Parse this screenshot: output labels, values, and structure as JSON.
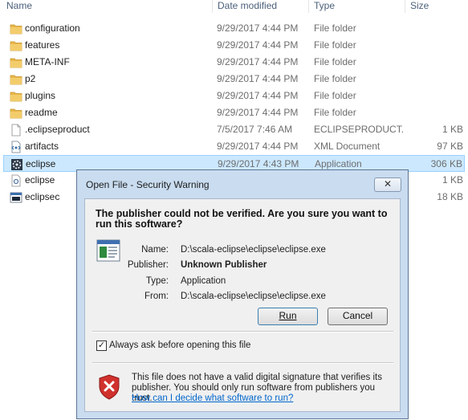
{
  "columns": {
    "name": "Name",
    "date_modified": "Date modified",
    "type": "Type",
    "size": "Size"
  },
  "files": [
    {
      "name": "configuration",
      "date": "9/29/2017 4:44 PM",
      "type": "File folder",
      "size": "",
      "icon": "folder-icon"
    },
    {
      "name": "features",
      "date": "9/29/2017 4:44 PM",
      "type": "File folder",
      "size": "",
      "icon": "folder-icon"
    },
    {
      "name": "META-INF",
      "date": "9/29/2017 4:44 PM",
      "type": "File folder",
      "size": "",
      "icon": "folder-icon"
    },
    {
      "name": "p2",
      "date": "9/29/2017 4:44 PM",
      "type": "File folder",
      "size": "",
      "icon": "folder-icon"
    },
    {
      "name": "plugins",
      "date": "9/29/2017 4:44 PM",
      "type": "File folder",
      "size": "",
      "icon": "folder-icon"
    },
    {
      "name": "readme",
      "date": "9/29/2017 4:44 PM",
      "type": "File folder",
      "size": "",
      "icon": "folder-icon"
    },
    {
      "name": ".eclipseproduct",
      "date": "7/5/2017 7:46 AM",
      "type": "ECLIPSEPRODUCT...",
      "size": "1 KB",
      "icon": "file-icon"
    },
    {
      "name": "artifacts",
      "date": "9/29/2017 4:44 PM",
      "type": "XML Document",
      "size": "97 KB",
      "icon": "xml-file-icon"
    },
    {
      "name": "eclipse",
      "date": "9/29/2017 4:43 PM",
      "type": "Application",
      "size": "306 KB",
      "icon": "eclipse-app-icon",
      "selected": true
    },
    {
      "name": "eclipse",
      "date": "",
      "type": "",
      "size": "1 KB",
      "icon": "config-file-icon"
    },
    {
      "name": "eclipsec",
      "date": "",
      "type": "",
      "size": "18 KB",
      "icon": "console-app-icon"
    }
  ],
  "dialog": {
    "title": "Open File - Security Warning",
    "close_glyph": "✕",
    "question": "The publisher could not be verified.  Are you sure you want to run this software?",
    "labels": {
      "name": "Name:",
      "publisher": "Publisher:",
      "type": "Type:",
      "from": "From:"
    },
    "values": {
      "name": "D:\\scala-eclipse\\eclipse\\eclipse.exe",
      "publisher": "Unknown Publisher",
      "type": "Application",
      "from": "D:\\scala-eclipse\\eclipse\\eclipse.exe"
    },
    "run_label": "Run",
    "cancel_label": "Cancel",
    "always_ask_label": "Always ask before opening this file",
    "always_ask_checked": true,
    "warning_text": "This file does not have a valid digital signature that verifies its publisher.  You should only run software from publishers you trust.",
    "help_link": "How can I decide what software to run?"
  },
  "colors": {
    "selection": "#cce8ff",
    "folder": "#e8b84a",
    "link": "#0066cc",
    "shield_red": "#d0312d"
  }
}
